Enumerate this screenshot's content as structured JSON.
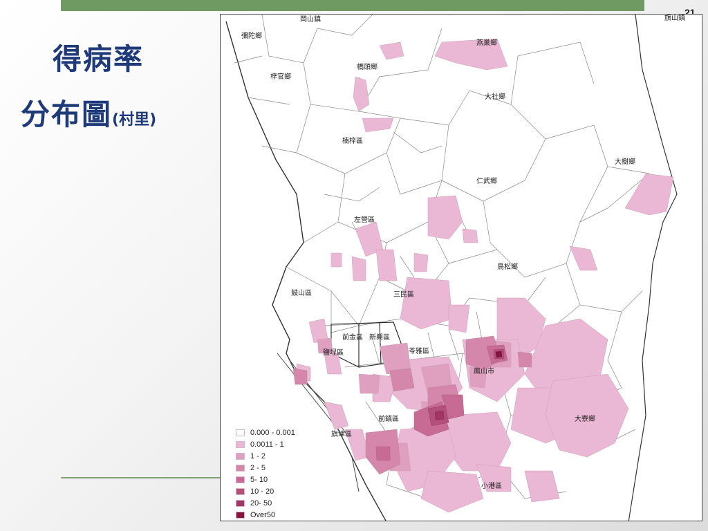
{
  "slide": {
    "page_number": "21",
    "title_line1": "得病率",
    "title_line2": "分布圖",
    "title_suffix": "(村里)"
  },
  "map": {
    "districts": [
      {
        "name": "岡山鎮"
      },
      {
        "name": "旗山鎮"
      },
      {
        "name": "彌陀鄉"
      },
      {
        "name": "燕巢鄉"
      },
      {
        "name": "橋頭鄉"
      },
      {
        "name": "梓官鄉"
      },
      {
        "name": "大社鄉"
      },
      {
        "name": "楠梓區"
      },
      {
        "name": "大樹鄉"
      },
      {
        "name": "仁武鄉"
      },
      {
        "name": "左營區"
      },
      {
        "name": "鳥松鄉"
      },
      {
        "name": "鼓山區"
      },
      {
        "name": "三民區"
      },
      {
        "name": "前金區"
      },
      {
        "name": "新興區"
      },
      {
        "name": "鹽埕區"
      },
      {
        "name": "苓雅區"
      },
      {
        "name": "鳳山市"
      },
      {
        "name": "前鎮區"
      },
      {
        "name": "大寮鄉"
      },
      {
        "name": "旗津區"
      },
      {
        "name": "小港區"
      }
    ],
    "legend": [
      {
        "label": "0.000 - 0.001",
        "color": "#ffffff"
      },
      {
        "label": "0.0011 - 1",
        "color": "#eab8d4"
      },
      {
        "label": "1 - 2",
        "color": "#df9fbf"
      },
      {
        "label": "2 - 5",
        "color": "#d486ab"
      },
      {
        "label": "5- 10",
        "color": "#c76a94"
      },
      {
        "label": "10 - 20",
        "color": "#b44f7a"
      },
      {
        "label": "20- 50",
        "color": "#a03566"
      },
      {
        "label": "Over50",
        "color": "#85143f"
      }
    ]
  }
}
